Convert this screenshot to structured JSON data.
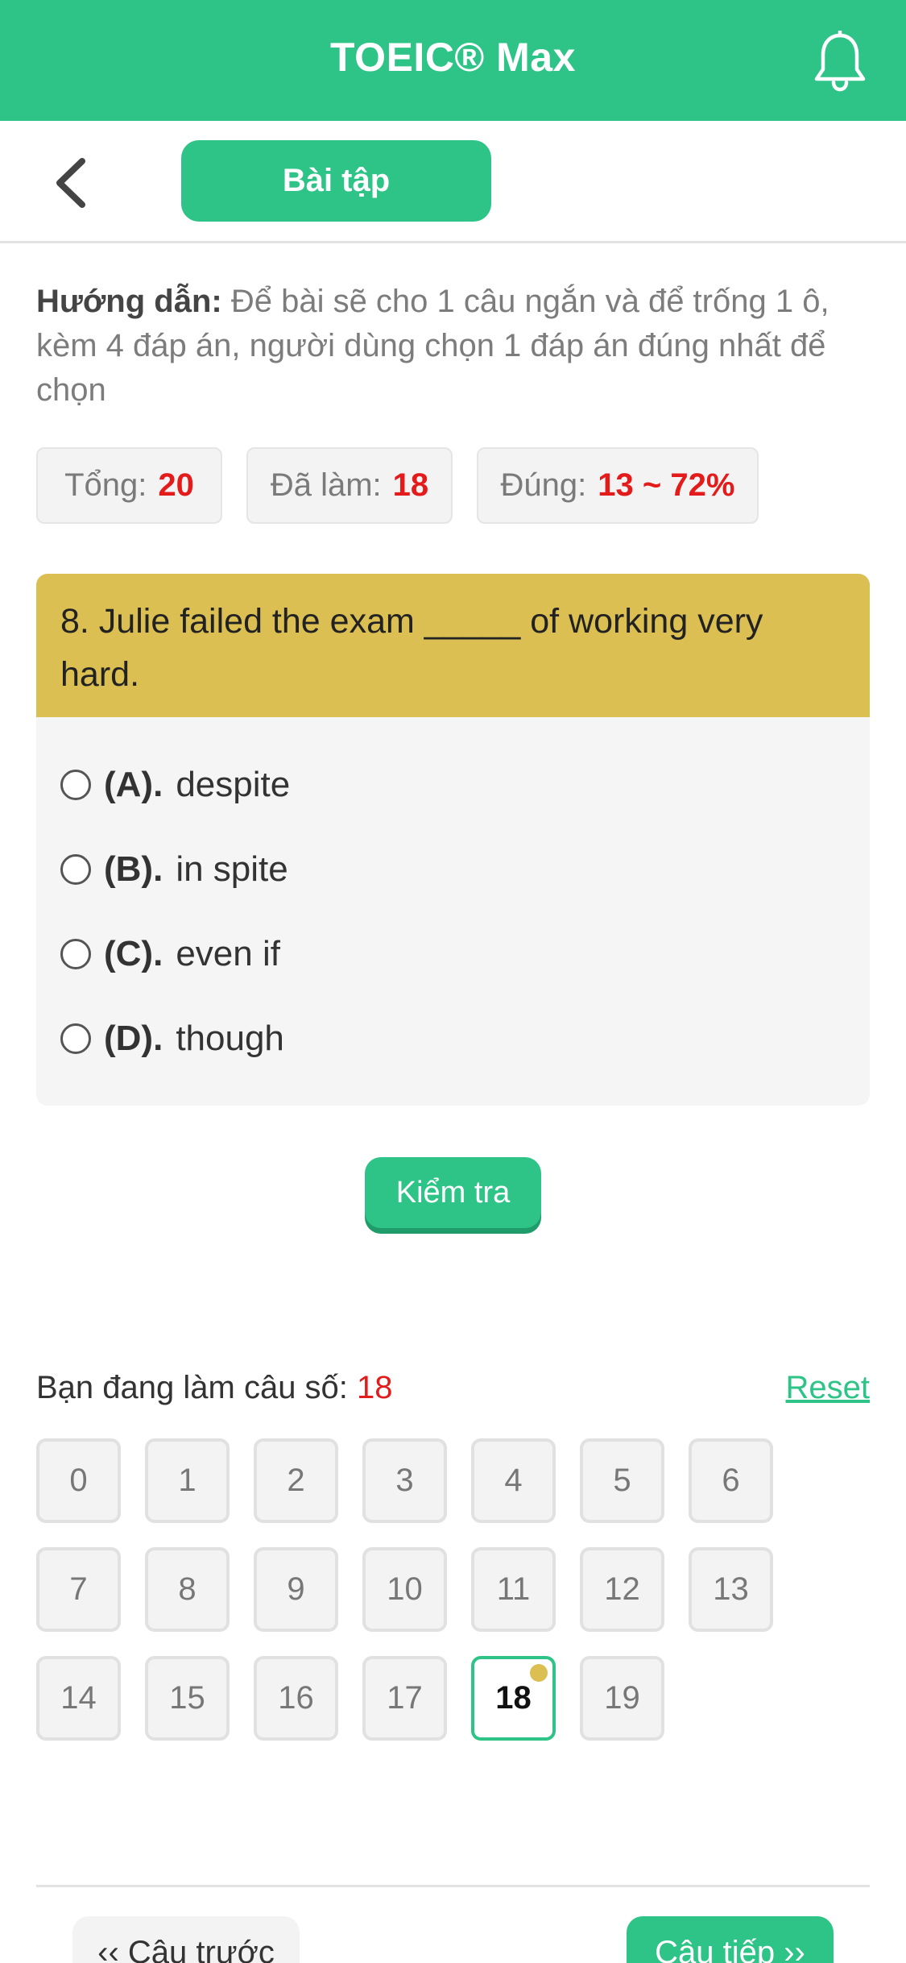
{
  "header": {
    "title": "TOEIC® Max"
  },
  "subbar": {
    "tab_label": "Bài tập"
  },
  "guide": {
    "label": "Hướng dẫn:",
    "text": "Để bài sẽ cho 1 câu ngắn và để trống 1 ô, kèm 4 đáp án, người dùng chọn 1 đáp án đúng nhất để chọn"
  },
  "stats": {
    "total_label": "Tổng:",
    "total_value": "20",
    "done_label": "Đã làm:",
    "done_value": "18",
    "correct_label": "Đúng:",
    "correct_value": "13 ~ 72%"
  },
  "question": {
    "text": "8. Julie failed the exam _____ of working very hard.",
    "options": [
      {
        "letter": "(A).",
        "text": "despite"
      },
      {
        "letter": "(B).",
        "text": "in spite"
      },
      {
        "letter": "(C).",
        "text": "even if"
      },
      {
        "letter": "(D).",
        "text": "though"
      }
    ]
  },
  "check_button": "Kiểm tra",
  "progress": {
    "label": "Bạn đang làm câu số:",
    "current": "18",
    "reset_label": "Reset"
  },
  "grid": [
    "0",
    "1",
    "2",
    "3",
    "4",
    "5",
    "6",
    "7",
    "8",
    "9",
    "10",
    "11",
    "12",
    "13",
    "14",
    "15",
    "16",
    "17",
    "18",
    "19"
  ],
  "footer": {
    "prev_label": "‹‹ Câu trước",
    "next_label": "Câu tiếp ››"
  },
  "colors": {
    "accent": "#2ec487",
    "question_bg": "#dbbf52",
    "highlight_number": "#e31b1b"
  }
}
